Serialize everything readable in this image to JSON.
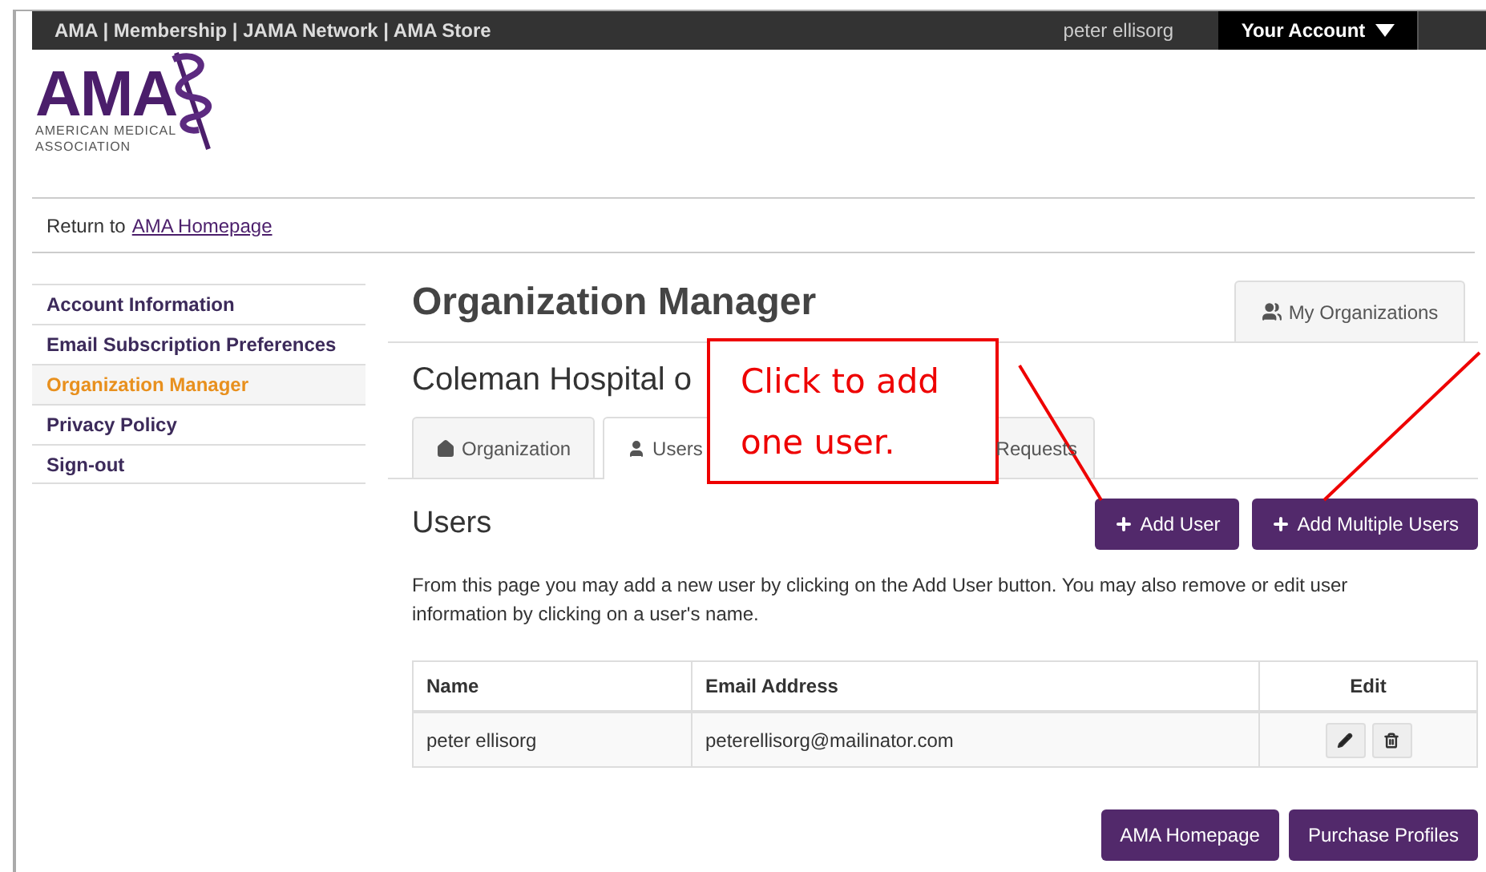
{
  "top_bar": {
    "links": "AMA | Membership | JAMA Network | AMA Store",
    "user": "peter ellisorg",
    "account_menu": "Your Account"
  },
  "logo": {
    "wordmark": "AMA",
    "line_1": "AMERICAN MEDICAL",
    "line_2": "ASSOCIATION"
  },
  "return_link": {
    "prefix": "Return to",
    "link": "AMA Homepage"
  },
  "sidebar": {
    "items": [
      {
        "label": "Account Information",
        "selected": false
      },
      {
        "label": "Email Subscription Preferences",
        "selected": false
      },
      {
        "label": "Organization Manager",
        "selected": true
      },
      {
        "label": "Privacy Policy",
        "selected": false
      },
      {
        "label": "Sign-out",
        "selected": false
      }
    ]
  },
  "page_title": "Organization Manager",
  "my_organizations_tab": "My Organizations",
  "organization_name": "Coleman Hospital o",
  "tabs": [
    {
      "label": "Organization",
      "selected": false
    },
    {
      "label": "Users",
      "selected": true
    },
    {
      "label": "Requests",
      "selected": false
    }
  ],
  "section_title": "Users",
  "actions": [
    "Add User",
    "Add Multiple Users"
  ],
  "description": "From this page you may add a new user by clicking on the Add User button. You may also remove or edit user information by clicking on a user's name.",
  "table": {
    "columns": [
      "Name",
      "Email Address",
      "Edit"
    ],
    "rows": [
      {
        "name": "peter ellisorg",
        "email": "peterellisorg@mailinator.com"
      }
    ]
  },
  "footer_buttons": [
    "AMA Homepage",
    "Purchase Profiles"
  ],
  "callout": {
    "line_1": "Click to add",
    "line_2": "one user."
  }
}
